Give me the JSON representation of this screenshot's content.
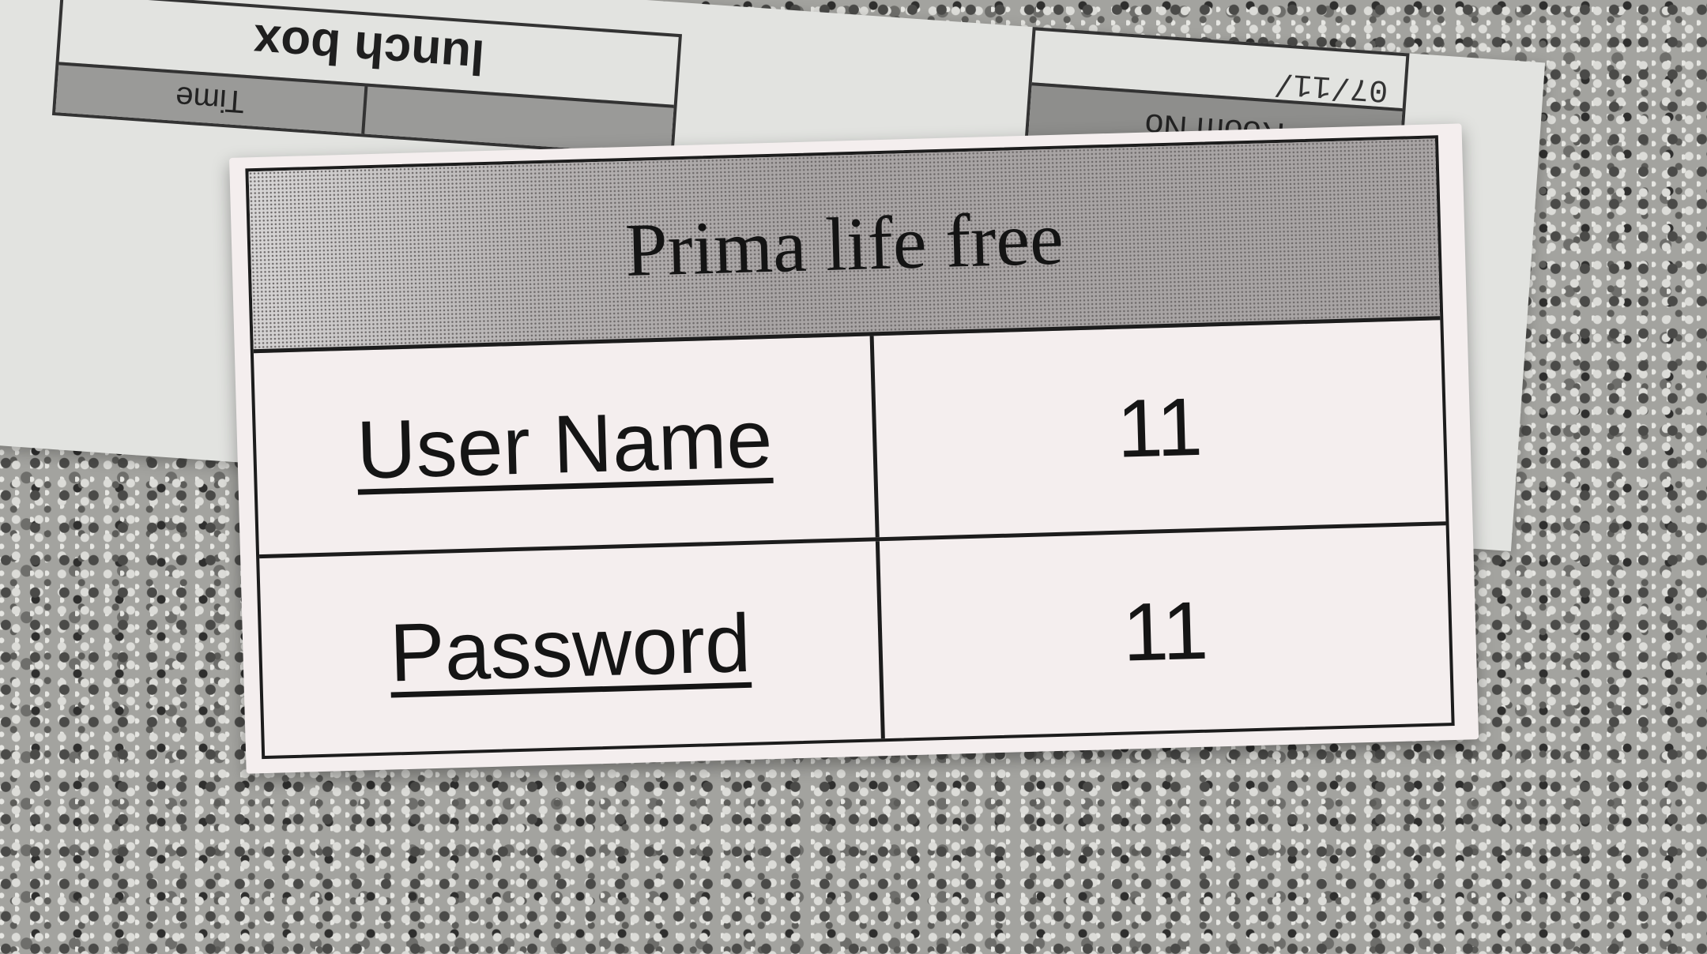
{
  "background_sheet": {
    "lunch_label": "lunch box",
    "time_label": "Time",
    "room_label": "Room No",
    "date_fragment": "07/11/"
  },
  "slip": {
    "title": "Prima life free",
    "rows": [
      {
        "label": "User Name",
        "value": "11"
      },
      {
        "label": "Password",
        "value": "11"
      }
    ]
  }
}
